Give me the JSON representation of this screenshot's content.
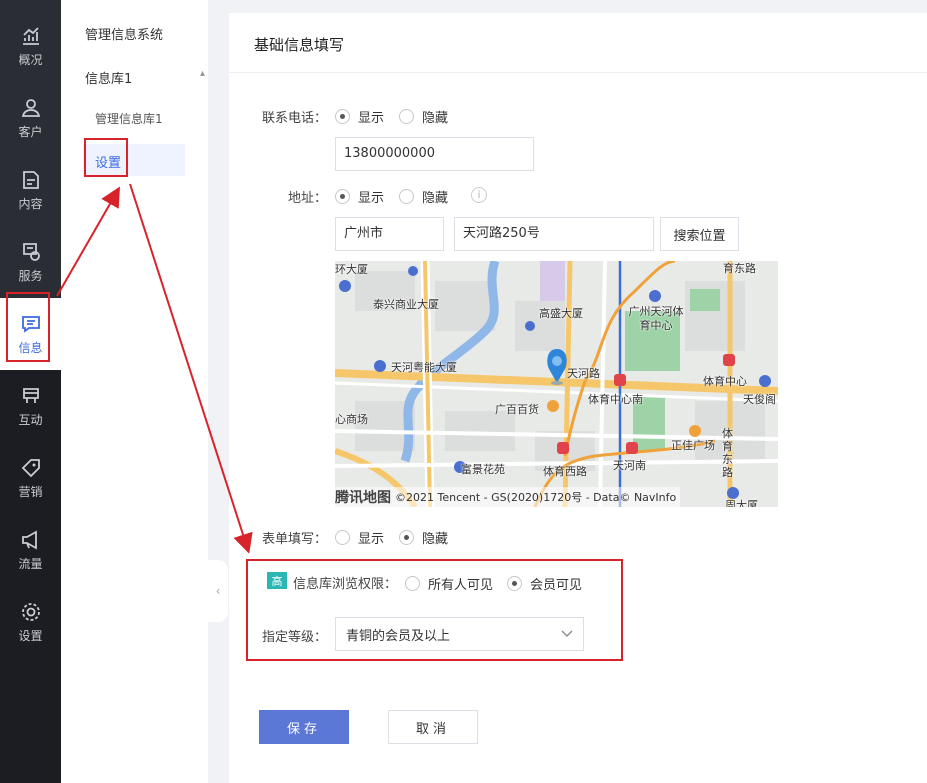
{
  "rail": {
    "items": [
      {
        "label": "概况",
        "icon": "chart-icon"
      },
      {
        "label": "客户",
        "icon": "user-icon"
      },
      {
        "label": "内容",
        "icon": "document-icon"
      },
      {
        "label": "服务",
        "icon": "service-icon"
      },
      {
        "label": "信息",
        "icon": "message-icon"
      },
      {
        "label": "互动",
        "icon": "interaction-icon"
      },
      {
        "label": "营销",
        "icon": "tag-icon"
      },
      {
        "label": "流量",
        "icon": "megaphone-icon"
      },
      {
        "label": "设置",
        "icon": "gear-icon"
      }
    ],
    "active_label": "信息"
  },
  "subnav": {
    "title": "管理信息系统",
    "group": "信息库1",
    "items": [
      "管理信息库1",
      "设置"
    ],
    "active": "设置"
  },
  "card": {
    "title": "基础信息填写"
  },
  "form": {
    "phone": {
      "label": "联系电话：",
      "options": [
        "显示",
        "隐藏"
      ],
      "selected": "显示",
      "value": "13800000000"
    },
    "address": {
      "label": "地址：",
      "options": [
        "显示",
        "隐藏"
      ],
      "selected": "显示",
      "info": "i",
      "city": "广州市",
      "street": "天河路250号",
      "search_button": "搜索位置"
    },
    "map": {
      "labels": [
        "环大厦",
        "育东路",
        "泰兴商业大厦",
        "高盛大厦",
        "广州天河体育中心",
        "天河粤能大厦",
        "天河路",
        "体育中心",
        "广百百货",
        "体育中心南",
        "天俊阁",
        "心商场",
        "正佳广场",
        "体育东路",
        "富景花苑",
        "体育西路",
        "天河南",
        "周大厦"
      ],
      "logo": "腾讯地图",
      "copyright": "©2021 Tencent - GS(2020)1720号 - Data© NavInfo"
    },
    "form_fill": {
      "label": "表单填写：",
      "options": [
        "显示",
        "隐藏"
      ],
      "selected": "隐藏"
    },
    "permission": {
      "badge": "高",
      "label": "信息库浏览权限：",
      "options": [
        "所有人可见",
        "会员可见"
      ],
      "selected": "会员可见"
    },
    "level": {
      "label": "指定等级：",
      "value": "青铜的会员及以上"
    }
  },
  "actions": {
    "save": "保存",
    "cancel": "取消"
  },
  "colors": {
    "accent": "#3d6ae3",
    "highlight": "#d8232a",
    "save_button": "#5b78d6",
    "rail_bg": "#1b1d22"
  }
}
